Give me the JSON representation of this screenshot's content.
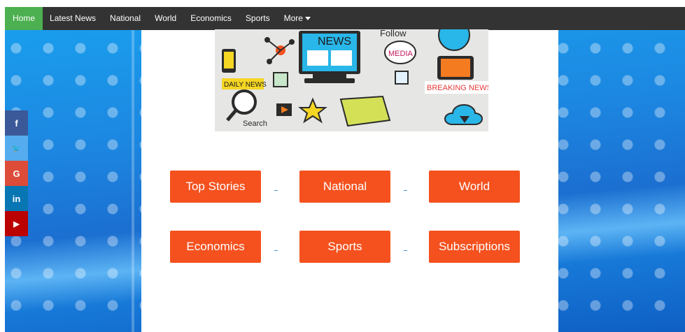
{
  "navbar": {
    "items": [
      {
        "label": "Home",
        "active": true
      },
      {
        "label": "Latest News"
      },
      {
        "label": "National"
      },
      {
        "label": "World"
      },
      {
        "label": "Economics"
      },
      {
        "label": "Sports"
      },
      {
        "label": "More"
      }
    ]
  },
  "hero": {
    "news": "NEWS",
    "follow": "Follow",
    "media": "MEDIA",
    "daily_news": "DAILY NEWS",
    "breaking_news": "BREAKING NEWS",
    "search": "Search"
  },
  "social": [
    {
      "icon": "facebook-icon",
      "glyph": "f",
      "color": "#3b5998"
    },
    {
      "icon": "twitter-icon",
      "glyph": "🐦",
      "color": "#55acee"
    },
    {
      "icon": "google-icon",
      "glyph": "G",
      "color": "#dd4b39"
    },
    {
      "icon": "linkedin-icon",
      "glyph": "in",
      "color": "#0976b4"
    },
    {
      "icon": "youtube-icon",
      "glyph": "▶",
      "color": "#bb0000"
    }
  ],
  "buttons": {
    "top_stories": "Top Stories",
    "national": "National",
    "world": "World",
    "economics": "Economics",
    "sports": "Sports",
    "subscriptions": "Subscriptions"
  },
  "colors": {
    "accent": "#f4511e",
    "nav_bg": "#333333",
    "nav_active": "#4CAF50"
  }
}
